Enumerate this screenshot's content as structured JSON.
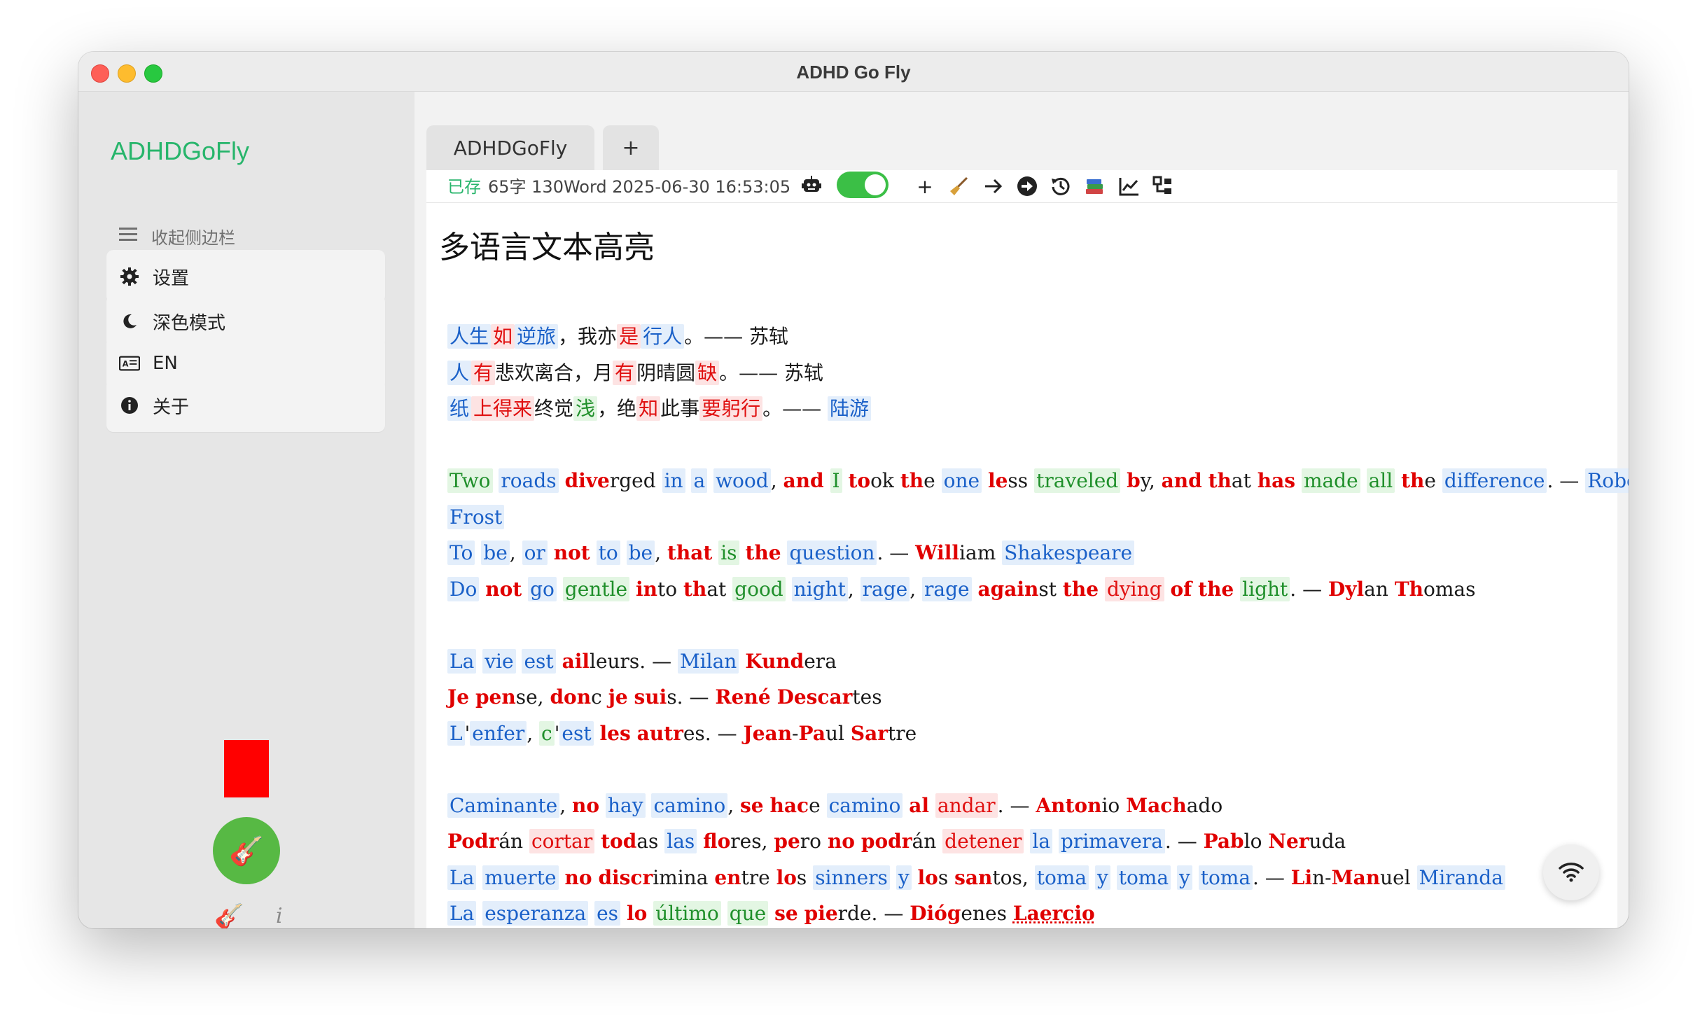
{
  "window": {
    "title": "ADHD Go Fly"
  },
  "sidebar": {
    "brand": "ADHDGoFly",
    "collapse_label": "收起侧边栏",
    "menu": [
      {
        "label": "设置",
        "icon": "gear-icon"
      },
      {
        "label": "深色模式",
        "icon": "moon-icon"
      },
      {
        "label": "EN",
        "icon": "language-icon"
      },
      {
        "label": "关于",
        "icon": "info-icon"
      }
    ],
    "fab_icon": "🎸",
    "small_guitar": "🎸",
    "small_info": "i"
  },
  "tabs": {
    "active": "ADHDGoFly",
    "add": "+"
  },
  "status": {
    "saved": "已存",
    "info": "65字 130Word 2025-06-30 16:53:05",
    "toggle_on": true
  },
  "toolbar": {
    "icons": [
      "plus-icon",
      "broom-icon",
      "arrow-right-icon",
      "circle-arrow-icon",
      "history-icon",
      "books-icon",
      "chart-icon",
      "tree-icon"
    ],
    "plus_label": "+"
  },
  "document": {
    "title": "多语言文本高亮",
    "lines": [
      [
        [
          "人生",
          "b"
        ],
        [
          "",
          ""
        ],
        [
          "如",
          "r"
        ],
        [
          "",
          ""
        ],
        [
          "逆旅",
          "b"
        ],
        [
          "，我亦",
          ""
        ],
        [
          "是",
          "r"
        ],
        [
          "",
          ""
        ],
        [
          "行人",
          "b"
        ],
        [
          "。—— 苏轼",
          ""
        ]
      ],
      [
        [
          "人",
          "b"
        ],
        [
          "",
          ""
        ],
        [
          "有",
          "r"
        ],
        [
          "悲欢离合，月",
          ""
        ],
        [
          "有",
          "r"
        ],
        [
          "阴晴圆",
          ""
        ],
        [
          "缺",
          "r"
        ],
        [
          "。—— 苏轼",
          ""
        ]
      ],
      [
        [
          "纸",
          "b"
        ],
        [
          "",
          ""
        ],
        [
          "上得来",
          "r"
        ],
        [
          "终觉",
          ""
        ],
        [
          "浅",
          "g"
        ],
        [
          "，绝",
          ""
        ],
        [
          "知",
          "r"
        ],
        [
          "此事",
          ""
        ],
        [
          "要躬行",
          "r"
        ],
        [
          "。—— ",
          ""
        ],
        [
          "陆游",
          "b"
        ]
      ],
      null,
      [
        [
          "Two",
          "g"
        ],
        [
          " ",
          ""
        ],
        [
          "roads",
          "b"
        ],
        [
          " ",
          ""
        ],
        [
          "dive",
          "B"
        ],
        [
          "rged ",
          ""
        ],
        [
          "in",
          "b"
        ],
        [
          " ",
          ""
        ],
        [
          "a",
          "b"
        ],
        [
          " ",
          ""
        ],
        [
          "wood",
          "b"
        ],
        [
          ", ",
          ""
        ],
        [
          "and",
          "B"
        ],
        [
          " ",
          ""
        ],
        [
          "I",
          "g"
        ],
        [
          " ",
          ""
        ],
        [
          "to",
          "B"
        ],
        [
          "ok ",
          ""
        ],
        [
          "th",
          "B"
        ],
        [
          "e ",
          ""
        ],
        [
          "one",
          "b"
        ],
        [
          " ",
          ""
        ],
        [
          "le",
          "B"
        ],
        [
          "ss ",
          ""
        ],
        [
          "traveled",
          "g"
        ],
        [
          " ",
          ""
        ],
        [
          "b",
          "B"
        ],
        [
          "y, ",
          ""
        ],
        [
          "and",
          "B"
        ],
        [
          " ",
          ""
        ],
        [
          "th",
          "B"
        ],
        [
          "at ",
          ""
        ],
        [
          "has",
          "B"
        ],
        [
          " ",
          ""
        ],
        [
          "made",
          "g"
        ],
        [
          " ",
          ""
        ],
        [
          "all",
          "g"
        ],
        [
          " ",
          ""
        ],
        [
          "th",
          "B"
        ],
        [
          "e ",
          ""
        ],
        [
          "difference",
          "b"
        ],
        [
          ". — ",
          ""
        ],
        [
          "Robert",
          "b"
        ]
      ],
      [
        [
          "Frost",
          "b"
        ]
      ],
      [
        [
          "To",
          "b"
        ],
        [
          " ",
          ""
        ],
        [
          "be",
          "b"
        ],
        [
          ", ",
          ""
        ],
        [
          "or",
          "b"
        ],
        [
          " ",
          ""
        ],
        [
          "not",
          "B"
        ],
        [
          " ",
          ""
        ],
        [
          "to",
          "b"
        ],
        [
          " ",
          ""
        ],
        [
          "be",
          "b"
        ],
        [
          ", ",
          ""
        ],
        [
          "that",
          "B"
        ],
        [
          " ",
          ""
        ],
        [
          "is",
          "g"
        ],
        [
          " ",
          ""
        ],
        [
          "the",
          "B"
        ],
        [
          " ",
          ""
        ],
        [
          "question",
          "b"
        ],
        [
          ". — ",
          ""
        ],
        [
          "Will",
          "B"
        ],
        [
          "iam ",
          ""
        ],
        [
          "Shakespeare",
          "b"
        ]
      ],
      [
        [
          "Do",
          "b"
        ],
        [
          " ",
          ""
        ],
        [
          "not",
          "B"
        ],
        [
          " ",
          ""
        ],
        [
          "go",
          "b"
        ],
        [
          " ",
          ""
        ],
        [
          "gentle",
          "g"
        ],
        [
          " ",
          ""
        ],
        [
          "in",
          "B"
        ],
        [
          "to ",
          ""
        ],
        [
          "th",
          "B"
        ],
        [
          "at ",
          ""
        ],
        [
          "good",
          "g"
        ],
        [
          " ",
          ""
        ],
        [
          "night",
          "b"
        ],
        [
          ", ",
          ""
        ],
        [
          "rage",
          "b"
        ],
        [
          ", ",
          ""
        ],
        [
          "rage",
          "b"
        ],
        [
          " ",
          ""
        ],
        [
          "again",
          "B"
        ],
        [
          "st ",
          ""
        ],
        [
          "the",
          "B"
        ],
        [
          " ",
          ""
        ],
        [
          "dying",
          "r"
        ],
        [
          " ",
          ""
        ],
        [
          "of",
          "B"
        ],
        [
          " ",
          ""
        ],
        [
          "the",
          "B"
        ],
        [
          " ",
          ""
        ],
        [
          "light",
          "g"
        ],
        [
          ". — ",
          ""
        ],
        [
          "Dyl",
          "B"
        ],
        [
          "an ",
          ""
        ],
        [
          "Th",
          "B"
        ],
        [
          "omas",
          ""
        ]
      ],
      null,
      [
        [
          "La",
          "b"
        ],
        [
          " ",
          ""
        ],
        [
          "vie",
          "b"
        ],
        [
          " ",
          ""
        ],
        [
          "est",
          "b"
        ],
        [
          " ",
          ""
        ],
        [
          "ail",
          "B"
        ],
        [
          "leurs. — ",
          ""
        ],
        [
          "Milan",
          "b"
        ],
        [
          " ",
          ""
        ],
        [
          "Kund",
          "B"
        ],
        [
          "era",
          ""
        ]
      ],
      [
        [
          "Je",
          "B"
        ],
        [
          " ",
          ""
        ],
        [
          "pen",
          "B"
        ],
        [
          "se, ",
          ""
        ],
        [
          "don",
          "B"
        ],
        [
          "c ",
          ""
        ],
        [
          "je",
          "B"
        ],
        [
          " ",
          ""
        ],
        [
          "sui",
          "B"
        ],
        [
          "s. — ",
          ""
        ],
        [
          "René",
          "B"
        ],
        [
          " ",
          ""
        ],
        [
          "Descar",
          "B"
        ],
        [
          "tes",
          ""
        ]
      ],
      [
        [
          "L",
          "b"
        ],
        [
          "'",
          ""
        ],
        [
          "enfer",
          "b"
        ],
        [
          ", ",
          ""
        ],
        [
          "c",
          "g"
        ],
        [
          "'",
          ""
        ],
        [
          "est",
          "b"
        ],
        [
          " ",
          ""
        ],
        [
          "les",
          "B"
        ],
        [
          " ",
          ""
        ],
        [
          "autr",
          "B"
        ],
        [
          "es. — ",
          ""
        ],
        [
          "Jean",
          "B"
        ],
        [
          "-",
          ""
        ],
        [
          "Pa",
          "B"
        ],
        [
          "ul ",
          ""
        ],
        [
          "Sar",
          "B"
        ],
        [
          "tre",
          ""
        ]
      ],
      null,
      [
        [
          "Caminante",
          "b"
        ],
        [
          ", ",
          ""
        ],
        [
          "no",
          "B"
        ],
        [
          " ",
          ""
        ],
        [
          "hay",
          "b"
        ],
        [
          " ",
          ""
        ],
        [
          "camino",
          "b"
        ],
        [
          ", ",
          ""
        ],
        [
          "se",
          "B"
        ],
        [
          " ",
          ""
        ],
        [
          "hac",
          "B"
        ],
        [
          "e ",
          ""
        ],
        [
          "camino",
          "b"
        ],
        [
          " ",
          ""
        ],
        [
          "al",
          "B"
        ],
        [
          " ",
          ""
        ],
        [
          "andar",
          "r"
        ],
        [
          ". — ",
          ""
        ],
        [
          "Anton",
          "B"
        ],
        [
          "io ",
          ""
        ],
        [
          "Mach",
          "B"
        ],
        [
          "ado",
          ""
        ]
      ],
      [
        [
          "Podr",
          "B"
        ],
        [
          "án ",
          ""
        ],
        [
          "cortar",
          "r"
        ],
        [
          " ",
          ""
        ],
        [
          "tod",
          "B"
        ],
        [
          "as ",
          ""
        ],
        [
          "las",
          "b"
        ],
        [
          " ",
          ""
        ],
        [
          "flo",
          "B"
        ],
        [
          "res, ",
          ""
        ],
        [
          "pe",
          "B"
        ],
        [
          "ro ",
          ""
        ],
        [
          "no",
          "B"
        ],
        [
          " ",
          ""
        ],
        [
          "podr",
          "B"
        ],
        [
          "án ",
          ""
        ],
        [
          "detener",
          "r"
        ],
        [
          " ",
          ""
        ],
        [
          "la",
          "b"
        ],
        [
          " ",
          ""
        ],
        [
          "primavera",
          "b"
        ],
        [
          ". — ",
          ""
        ],
        [
          "Pab",
          "B"
        ],
        [
          "lo ",
          ""
        ],
        [
          "Ner",
          "B"
        ],
        [
          "uda",
          ""
        ]
      ],
      [
        [
          "La",
          "b"
        ],
        [
          " ",
          ""
        ],
        [
          "muerte",
          "b"
        ],
        [
          " ",
          ""
        ],
        [
          "no",
          "B"
        ],
        [
          " ",
          ""
        ],
        [
          "discr",
          "B"
        ],
        [
          "imina ",
          ""
        ],
        [
          "en",
          "B"
        ],
        [
          "tre ",
          ""
        ],
        [
          "lo",
          "B"
        ],
        [
          "s ",
          ""
        ],
        [
          "sinners",
          "b"
        ],
        [
          " ",
          ""
        ],
        [
          "y",
          "b"
        ],
        [
          " ",
          ""
        ],
        [
          "lo",
          "B"
        ],
        [
          "s ",
          ""
        ],
        [
          "san",
          "B"
        ],
        [
          "tos, ",
          ""
        ],
        [
          "toma",
          "b"
        ],
        [
          " ",
          ""
        ],
        [
          "y",
          "b"
        ],
        [
          " ",
          ""
        ],
        [
          "toma",
          "b"
        ],
        [
          " ",
          ""
        ],
        [
          "y",
          "b"
        ],
        [
          " ",
          ""
        ],
        [
          "toma",
          "b"
        ],
        [
          ". — ",
          ""
        ],
        [
          "Li",
          "B"
        ],
        [
          "n-",
          ""
        ],
        [
          "Man",
          "B"
        ],
        [
          "uel ",
          ""
        ],
        [
          "Miranda",
          "b"
        ]
      ],
      [
        [
          "La",
          "b"
        ],
        [
          " ",
          ""
        ],
        [
          "esperanza",
          "b"
        ],
        [
          " ",
          ""
        ],
        [
          "es",
          "b"
        ],
        [
          " ",
          ""
        ],
        [
          "lo",
          "B"
        ],
        [
          " ",
          ""
        ],
        [
          "último",
          "g"
        ],
        [
          " ",
          ""
        ],
        [
          "que",
          "g"
        ],
        [
          " ",
          ""
        ],
        [
          "se",
          "B"
        ],
        [
          " ",
          ""
        ],
        [
          "pie",
          "B"
        ],
        [
          "rde. — ",
          ""
        ],
        [
          "Dióg",
          "B"
        ],
        [
          "enes ",
          ""
        ],
        [
          "Laer",
          "S"
        ],
        [
          "cio",
          "S"
        ]
      ]
    ]
  }
}
